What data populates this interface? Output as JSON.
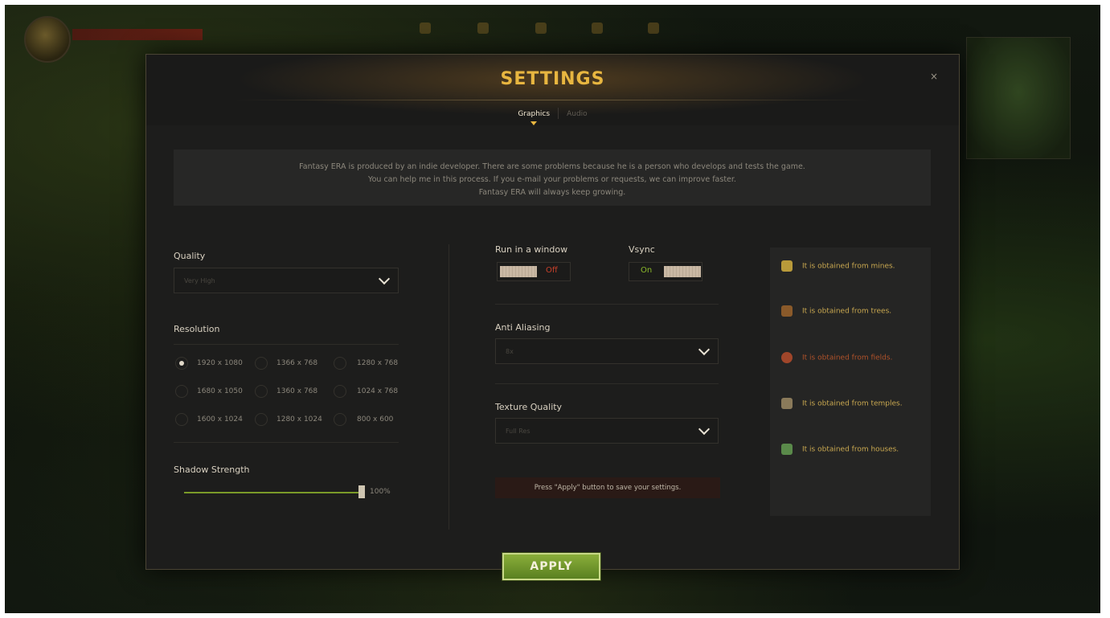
{
  "dialog": {
    "title": "SETTINGS",
    "close_label": "×"
  },
  "tabs": [
    {
      "label": "Graphics",
      "active": true
    },
    {
      "label": "Audio",
      "active": false
    }
  ],
  "notice": {
    "lines": [
      "Fantasy ERA is produced by an indie developer. There are some problems because he is a person who develops and tests the game.",
      "You can help me in this process. If you e-mail your problems or requests, we can improve faster.",
      "Fantasy ERA will always keep growing."
    ]
  },
  "quality": {
    "label": "Quality",
    "value": "Very High",
    "icon": "chevron-down-icon"
  },
  "resolution": {
    "label": "Resolution",
    "options": [
      "1920 x 1080",
      "1366 x 768",
      "1280 x 768",
      "1680 x 1050",
      "1360 x 768",
      "1024 x 768",
      "1600 x 1024",
      "1280 x 1024",
      "800 x 600"
    ],
    "selected": "1920 x 1080"
  },
  "shadow": {
    "label": "Shadow Strength",
    "value": 1.0,
    "value_label": "100%"
  },
  "run_in_window": {
    "label": "Run in a window",
    "state_label": "Off"
  },
  "vsync": {
    "label": "Vsync",
    "state_label": "On"
  },
  "anti_aliasing": {
    "label": "Anti Aliasing",
    "value": "8x"
  },
  "texture_quality": {
    "label": "Texture Quality",
    "value": "Full Res"
  },
  "hint": "Press \"Apply\" button to save your settings.",
  "info": [
    {
      "icon": "gold-ore-icon",
      "text": "It is obtained from mines.",
      "color": "#c9a850"
    },
    {
      "icon": "wood-log-icon",
      "text": "It is obtained from trees.",
      "color": "#c9a850"
    },
    {
      "icon": "meat-icon",
      "text": "It is obtained from fields.",
      "color": "#b0522a"
    },
    {
      "icon": "magic-icon",
      "text": "It is obtained from temples.",
      "color": "#c9a850"
    },
    {
      "icon": "herb-icon",
      "text": "It is obtained from houses.",
      "color": "#c9a850"
    }
  ],
  "apply_label": "APPLY",
  "colors": {
    "accent": "#e8b640",
    "apply_green": "#6f9428",
    "off_red": "#c8402a",
    "on_green": "#8ab82a"
  }
}
